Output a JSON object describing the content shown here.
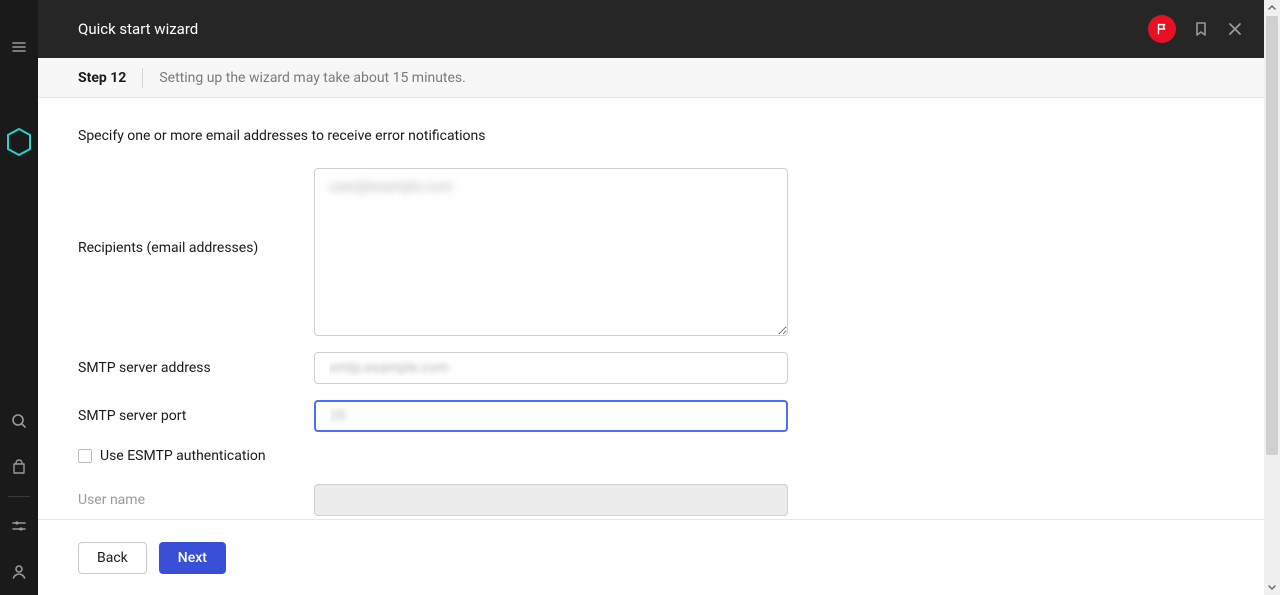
{
  "header": {
    "title": "Quick start wizard"
  },
  "step": {
    "label": "Step 12",
    "hint": "Setting up the wizard may take about 15 minutes."
  },
  "body": {
    "intro": "Specify one or more email addresses to receive error notifications",
    "recipients_label": "Recipients (email addresses)",
    "recipients_placeholder": "user@example.com",
    "smtp_address_label": "SMTP server address",
    "smtp_address_placeholder": "smtp.example.com",
    "smtp_port_label": "SMTP server port",
    "smtp_port_placeholder": "25",
    "esmtp_label": "Use ESMTP authentication",
    "username_label": "User name"
  },
  "footer": {
    "back": "Back",
    "next": "Next"
  }
}
